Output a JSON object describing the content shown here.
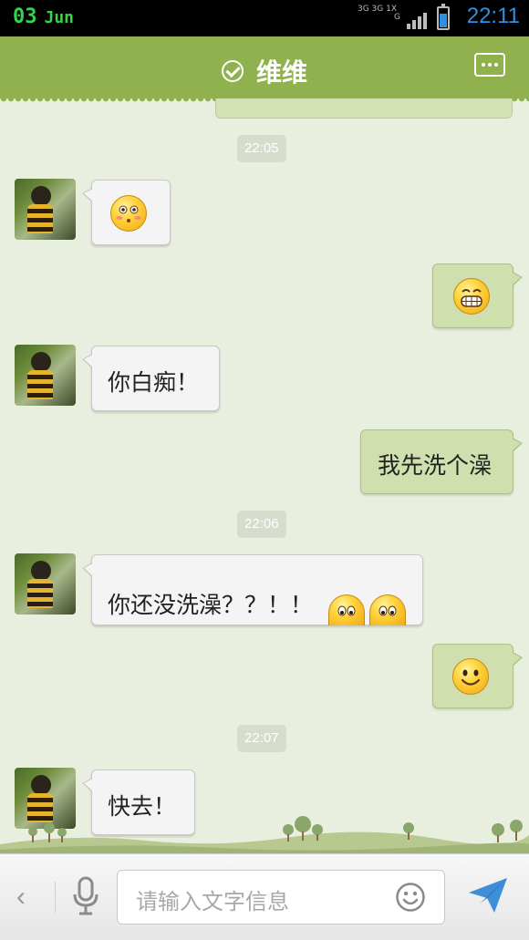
{
  "status_bar": {
    "date_day": "03",
    "date_month": "Jun",
    "network_top": "3G 3G 1X",
    "network_bottom": "G",
    "time": "22:11",
    "battery_level_percent": 70,
    "accent_color": "#37d24a",
    "time_color": "#2f8fe0"
  },
  "header": {
    "title": "维维",
    "check_icon": "check-circle-icon",
    "more_icon": "more-dots-icon",
    "background_color": "#8fb14e"
  },
  "chat": {
    "background_color": "#e9efdf",
    "timestamps": [
      "22:05",
      "22:06",
      "22:07"
    ],
    "messages": [
      {
        "side": "in",
        "text": "",
        "emoji": [
          "blushing-face-icon"
        ]
      },
      {
        "side": "out",
        "text": "",
        "emoji": [
          "grinning-teeth-face-icon"
        ]
      },
      {
        "side": "in",
        "text": "你白痴！",
        "emoji": []
      },
      {
        "side": "out",
        "text": "我先洗个澡",
        "emoji": []
      },
      {
        "side": "in",
        "text": "你还没洗澡？？！！",
        "emoji": [
          "peeking-face-icon",
          "peeking-face-icon"
        ]
      },
      {
        "side": "out",
        "text": "",
        "emoji": [
          "smiling-face-icon"
        ]
      },
      {
        "side": "in",
        "text": "快去！",
        "emoji": []
      }
    ]
  },
  "input_bar": {
    "back_label": "‹",
    "placeholder": "请输入文字信息",
    "mic_icon": "microphone-icon",
    "emoji_icon": "smiley-icon",
    "send_icon": "paper-plane-icon"
  }
}
